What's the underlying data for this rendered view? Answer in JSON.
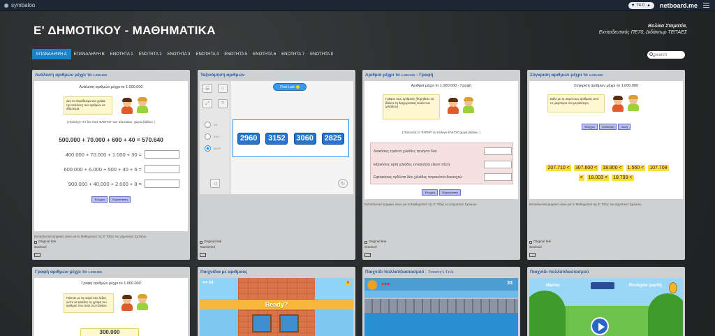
{
  "topbar": {
    "app_name": "symbaloo",
    "counter": "74.0",
    "brand": "netboard.me"
  },
  "header": {
    "title": "Ε' ΔΗΜΟΤΙΚΟΥ - ΜΑΘΗΜΑΤΙΚΑ",
    "author_name": "Βολίκα Σταματία,",
    "author_role": "Εκπαιδευτικός ΠΕ70, Διδάκτωρ ΤΕΠΑΕΣ"
  },
  "nav": {
    "tabs": [
      {
        "label": "ΕΠΑΝΑΛΗΨΗ Α",
        "active": true
      },
      {
        "label": "ΕΠΑΝΑΛΗΨΗ Β"
      },
      {
        "label": "ΕΝΟΤΗΤΑ 1"
      },
      {
        "label": "ΕΝΟΤΗΤΑ 2"
      },
      {
        "label": "ΕΝΟΤΗΤΑ 3"
      },
      {
        "label": "ΕΝΟΤΗΤΑ 4"
      },
      {
        "label": "ΕΝΟΤΗΤΑ 5"
      },
      {
        "label": "ΕΝΟΤΗΤΑ 6"
      },
      {
        "label": "ΕΝΟΤΗΤΑ 7"
      },
      {
        "label": "ΕΝΟΤΗΤΑ 8"
      }
    ],
    "search_placeholder": "Search"
  },
  "cards": {
    "c1": {
      "title": "Ανάλυση αριθμών μέχρι το",
      "title_small": "1.000.000",
      "ex_title": "Ανάλυση αριθμών μέχρι το 1.000.000",
      "bubble": "Δες το παράδειγμα και γράψε την ανάλυση των αριθμών σε άθροισμα.",
      "hint": "( Πρόσεχε! Η 0 δεν ποτέ 'ΕΛΕΓΧΟ' των τελευταίων, χώρου βιβλίου. )",
      "example": "500.000 + 70.000 + 600 + 40 = 570.640",
      "rows": [
        "400.000 + 70.000 + 1.000 + 30 =",
        "600.000 + 6.000 + 500 + 40 + 6 =",
        "900.000 + 40.000 + 2.000 + 8 ="
      ],
      "btn_check": "Έλεγχος",
      "btn_solution": "Παρουσίαση",
      "foot": "Εκπαιδευτικό ψηφιακό υλικό για τα Μαθηματικά της Ε' Τάξης του Δημοτικού Σχολείου.",
      "link": "Original link",
      "source": "itsschool"
    },
    "c2": {
      "title": "Ταξινόμηση αριθμών",
      "pill": "First Last",
      "numbers": [
        "2960",
        "3152",
        "3060",
        "2825"
      ],
      "radios": [
        "1/2",
        "3/10",
        "50/20"
      ],
      "link": "Original link",
      "source": "Teacherled"
    },
    "c3": {
      "title": "Αριθμοί μέχρι το",
      "title_small": "1.000.000",
      "title_suffix": "- Γραφή",
      "ex_title": "Αριθμοί μέχρι το 1.000.000 - Γραφή",
      "bubble": "Γράψτε τους αριθμούς (θυμηθείτε να βάλετε τη διαχωριστική τελεία των χιλιάδων)",
      "hint": "( Πατώντας το 'ENTER' αν επιλέγει ΕΛΕΓΧΟ χωρίς βιβλίου. )",
      "rows": [
        "Διακόσιες τριάντα χιλιάδες πενήντα δύο",
        "Εξακόσιες εφτά χιλιάδες εννιακόσια είκοσι πέντε",
        "Εφτακόσιες ογδόντα δύο χιλιάδες τετρακόσια δεκαοχτώ"
      ],
      "btn_check": "Έλεγχος",
      "btn_solution": "Παρουσίαση",
      "foot": "Εκπαιδευτικό ψηφιακό υλικό για τα Μαθηματικά της Ε' Τάξης του Δημοτικού Σχολείου.",
      "link": "Original link",
      "source": "itsschool"
    },
    "c4": {
      "title": "Σύγκριση αριθμών μέχρι το",
      "title_small": "1.000.000",
      "ex_title": "Σύγκριση αριθμών μέχρι το 1.000.000",
      "bubble": "Βάλε με τη σειρά τους αριθμούς από το μικρότερο στο μεγαλύτερο.",
      "btn_check": "Έλεγχος",
      "btn_reset": "Ανάκτηση",
      "btn_solution": "Λύση",
      "row1": [
        "207.710 <",
        "307.600 <",
        "18.800 <",
        "1.560 <",
        "107.709"
      ],
      "row2": [
        "<",
        "18.003 <",
        "18.799 <"
      ],
      "foot": "Εκπαιδευτικό ψηφιακό υλικό για τα Μαθηματικά της Ε' Τάξης του Δημοτικού Σχολείου.",
      "link": "Original link",
      "source": "itsschool"
    },
    "c5": {
      "title": "Γραφή αριθμών μέχρι το",
      "title_small": "1.000.000",
      "ex_title": "Γραφή αριθμών μέχρι το 1.000.000",
      "bubble": "Πάτησε με τη σειρά στις λέξεις ώστε να φτιάξεις τη γραφή του αριθμού που είναι στο πλαίσιο.",
      "number": "300.000"
    },
    "c6": {
      "title": "Παιχνίδια με αριθμούς",
      "ready": "Ready?",
      "score": "24"
    },
    "c7": {
      "title": "Παιχνίδι πολλαπλασιασμού",
      "title_suffix": "- Tommy's Trek",
      "score": "33"
    },
    "c8": {
      "title": "Παιχνίδι πολλαπλασιασμού",
      "p1": "Marion",
      "p2": "Rockgow (earth)"
    }
  }
}
